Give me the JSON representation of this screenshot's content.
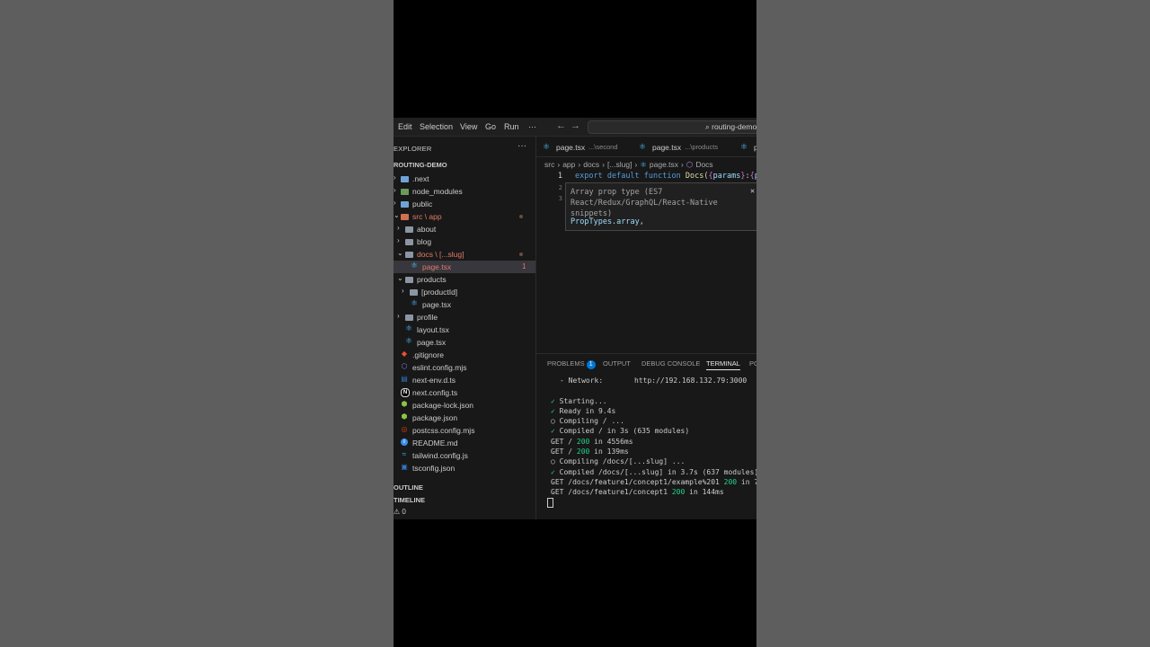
{
  "menu": [
    "Edit",
    "Selection",
    "View",
    "Go",
    "Run",
    "···"
  ],
  "search": {
    "text": "routing-demo"
  },
  "sidebar": {
    "explorer_title": "EXPLORER",
    "more": "···",
    "project": "ROUTING-DEMO",
    "items": [
      {
        "label": ".next",
        "icon": "folder"
      },
      {
        "label": "node_modules",
        "icon": "folder"
      },
      {
        "label": "public",
        "icon": "folder"
      },
      {
        "label": "src \\ app",
        "icon": "folder"
      },
      {
        "label": "about",
        "icon": "folder"
      },
      {
        "label": "blog",
        "icon": "folder"
      },
      {
        "label": "docs \\ [...slug]",
        "icon": "folder"
      },
      {
        "label": "page.tsx",
        "icon": "react",
        "count": "1"
      },
      {
        "label": "products",
        "icon": "folder"
      },
      {
        "label": "[productId]",
        "icon": "folder"
      },
      {
        "label": "page.tsx",
        "icon": "react"
      },
      {
        "label": "profile",
        "icon": "folder"
      },
      {
        "label": "layout.tsx",
        "icon": "react"
      },
      {
        "label": "page.tsx",
        "icon": "react"
      },
      {
        "label": ".gitignore",
        "icon": "git"
      },
      {
        "label": "eslint.config.mjs",
        "icon": "eslint"
      },
      {
        "label": "next-env.d.ts",
        "icon": "ts"
      },
      {
        "label": "next.config.ts",
        "icon": "next"
      },
      {
        "label": "package-lock.json",
        "icon": "npm"
      },
      {
        "label": "package.json",
        "icon": "npm"
      },
      {
        "label": "postcss.config.mjs",
        "icon": "postcss"
      },
      {
        "label": "README.md",
        "icon": "info"
      },
      {
        "label": "tailwind.config.js",
        "icon": "tailwind"
      },
      {
        "label": "tsconfig.json",
        "icon": "ts"
      }
    ],
    "outline": "OUTLINE",
    "timeline": "TIMELINE"
  },
  "status": {
    "warnings": "⚠ 0"
  },
  "tabs": [
    {
      "label": "page.tsx",
      "hint": "...\\second"
    },
    {
      "label": "page.tsx",
      "hint": "...\\products"
    },
    {
      "label": "p",
      "hint": ""
    }
  ],
  "breadcrumb": [
    "src",
    "›",
    "app",
    "›",
    "docs",
    "›",
    "[...slug]",
    "›",
    "⚛",
    "page.tsx",
    "›",
    "⬡",
    "Docs"
  ],
  "editor": {
    "line_numbers": [
      "1",
      "2",
      "3"
    ],
    "line1": {
      "kw1": "export",
      "kw2": "default",
      "kw3": "function",
      "fn": "Docs",
      "open": "(",
      "brace": "{",
      "param": "params",
      "close_brace": "}",
      "colon": ":",
      "type_brace": "{",
      "type": "p"
    }
  },
  "hover": {
    "text": "Array prop type (ES7 React/Redux/GraphQL/React-Native snippets)",
    "code": "PropTypes.array,",
    "close": "✕"
  },
  "panel": {
    "tabs": [
      "PROBLEMS",
      "OUTPUT",
      "DEBUG CONSOLE",
      "TERMINAL",
      "PO"
    ],
    "problems_count": "1",
    "terminal": {
      "network_label": "- Network:",
      "network_url": "http://192.168.132.79:3000",
      "lines": [
        {
          "mark": "✓",
          "text": " Starting..."
        },
        {
          "mark": "✓",
          "text": " Ready in 9.4s"
        },
        {
          "mark": "○",
          "text": " Compiling / ..."
        },
        {
          "mark": "✓",
          "text": " Compiled / in 3s (635 modules)"
        },
        {
          "pre": "GET / ",
          "code": "200",
          "post": " in 4556ms"
        },
        {
          "pre": "GET / ",
          "code": "200",
          "post": " in 139ms"
        },
        {
          "mark": "○",
          "text": " Compiling /docs/[...slug] ..."
        },
        {
          "mark": "✓",
          "text": " Compiled /docs/[...slug] in 3.7s (637 modules)"
        },
        {
          "pre": "GET /docs/feature1/concept1/example%201 ",
          "code": "200",
          "post": " in 7"
        },
        {
          "pre": "GET /docs/feature1/concept1 ",
          "code": "200",
          "post": " in 144ms"
        }
      ]
    }
  }
}
